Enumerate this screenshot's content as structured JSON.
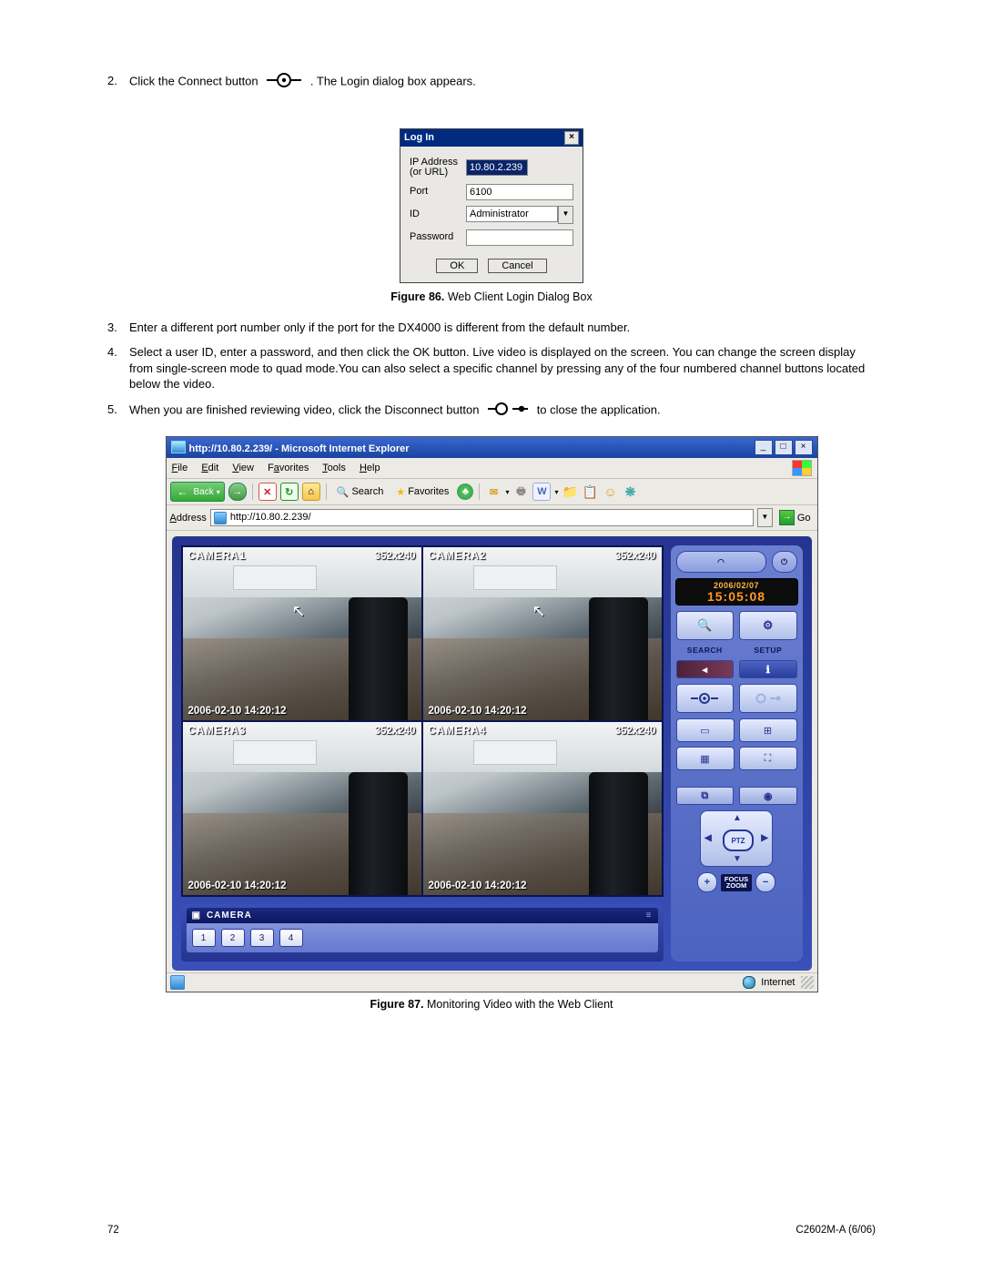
{
  "steps": {
    "s2a": "Click the Connect button",
    "s2b": ". The Login dialog box appears.",
    "s3": "Enter a different port number only if the port for the DX4000 is different from the default number.",
    "s4": "Select a user ID, enter a password, and then click the OK button. Live video is displayed on the screen. You can change the screen display from single-screen mode to quad mode.You can also select a specific channel by pressing any of the four numbered channel buttons located below the video.",
    "s5a": "When you are finished reviewing video, click the Disconnect button",
    "s5b": "to close the application."
  },
  "fig86": {
    "label": "Figure 86.",
    "caption": "Web Client Login Dialog Box"
  },
  "fig87": {
    "label": "Figure 87.",
    "caption": "Monitoring Video with the Web Client"
  },
  "login": {
    "title": "Log In",
    "ip_label": "IP Address (or URL)",
    "ip_value": "10.80.2.239",
    "port_label": "Port",
    "port_value": "6100",
    "id_label": "ID",
    "id_value": "Administrator",
    "pw_label": "Password",
    "ok": "OK",
    "cancel": "Cancel"
  },
  "ie": {
    "title": "http://10.80.2.239/ - Microsoft Internet Explorer",
    "menu": {
      "file": "File",
      "edit": "Edit",
      "view": "View",
      "fav": "Favorites",
      "tools": "Tools",
      "help": "Help"
    },
    "back": "Back",
    "search": "Search",
    "favorites": "Favorites",
    "addr_label": "Address",
    "addr_value": "http://10.80.2.239/",
    "go": "Go",
    "status_zone": "Internet"
  },
  "client": {
    "date": "2006/02/07",
    "time": "15:05:08",
    "search": "SEARCH",
    "setup": "SETUP",
    "ptz": "PTZ",
    "focus": "FOCUS",
    "zoom": "ZOOM",
    "camera_label": "CAMERA",
    "cams": [
      {
        "name": "CAMERA1",
        "res": "352x240",
        "ts": "2006-02-10 14:20:12"
      },
      {
        "name": "CAMERA2",
        "res": "352x240",
        "ts": "2006-02-10 14:20:12"
      },
      {
        "name": "CAMERA3",
        "res": "352x240",
        "ts": "2006-02-10 14:20:12"
      },
      {
        "name": "CAMERA4",
        "res": "352x240",
        "ts": "2006-02-10 14:20:12"
      }
    ],
    "channels": [
      "1",
      "2",
      "3",
      "4"
    ]
  },
  "footer": {
    "page": "72",
    "doc": "C2602M-A (6/06)"
  }
}
